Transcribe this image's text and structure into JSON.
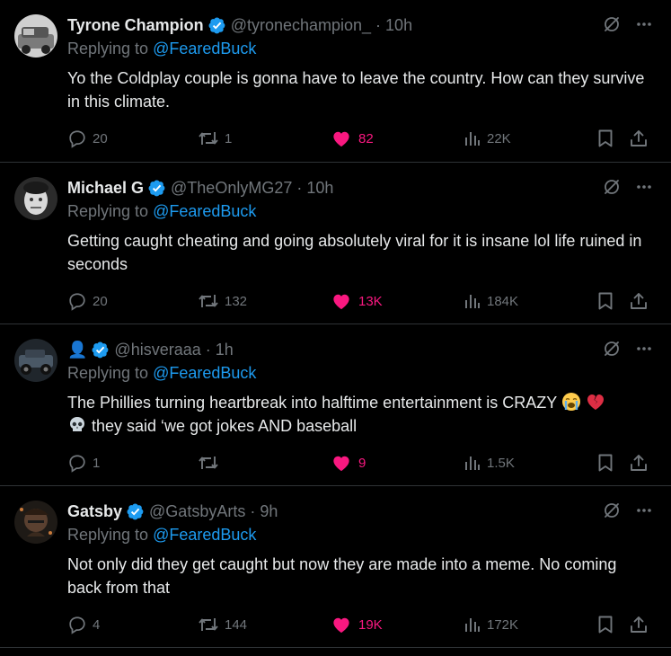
{
  "colors": {
    "background": "#000000",
    "text": "#e7e9ea",
    "muted": "#71767b",
    "link": "#1d9bf0",
    "liked": "#f91880",
    "divider": "#2f3336"
  },
  "reply_prefix": "Replying to",
  "tweets": [
    {
      "display_name": "Tyrone Champion",
      "handle": "@tyronechampion_",
      "time": "10h",
      "reply_to": "@FearedBuck",
      "text": "Yo the Coldplay couple is gonna have to leave the country. How can they survive in this climate.",
      "replies": "20",
      "reposts": "1",
      "likes": "82",
      "views": "22K",
      "avatar_icon": "avatar-icon",
      "avatar_color": "#9a9a9a"
    },
    {
      "display_name": "Michael G",
      "handle": "@TheOnlyMG27",
      "time": "10h",
      "reply_to": "@FearedBuck",
      "text": "Getting caught cheating and going absolutely viral for it is insane lol life ruined in seconds",
      "replies": "20",
      "reposts": "132",
      "likes": "13K",
      "views": "184K",
      "avatar_icon": "avatar-icon",
      "avatar_color": "#6b6b6b"
    },
    {
      "display_name": "👤",
      "handle": "@hisveraaa",
      "time": "1h",
      "reply_to": "@FearedBuck",
      "text_before": "The Phillies turning heartbreak into halftime entertainment is CRAZY",
      "text_after": "they said ‘we got jokes AND baseball",
      "emoji_names": [
        "loudly-crying-face-icon",
        "broken-heart-icon",
        "skull-icon"
      ],
      "replies": "1",
      "reposts": "",
      "likes": "9",
      "views": "1.5K",
      "avatar_icon": "avatar-icon",
      "avatar_color": "#3a4a5a"
    },
    {
      "display_name": "Gatsby",
      "handle": "@GatsbyArts",
      "time": "9h",
      "reply_to": "@FearedBuck",
      "text": "Not only did they get caught but now they are made into a meme. No coming back from that",
      "replies": "4",
      "reposts": "144",
      "likes": "19K",
      "views": "172K",
      "avatar_icon": "avatar-icon",
      "avatar_color": "#4a3a2a"
    }
  ]
}
